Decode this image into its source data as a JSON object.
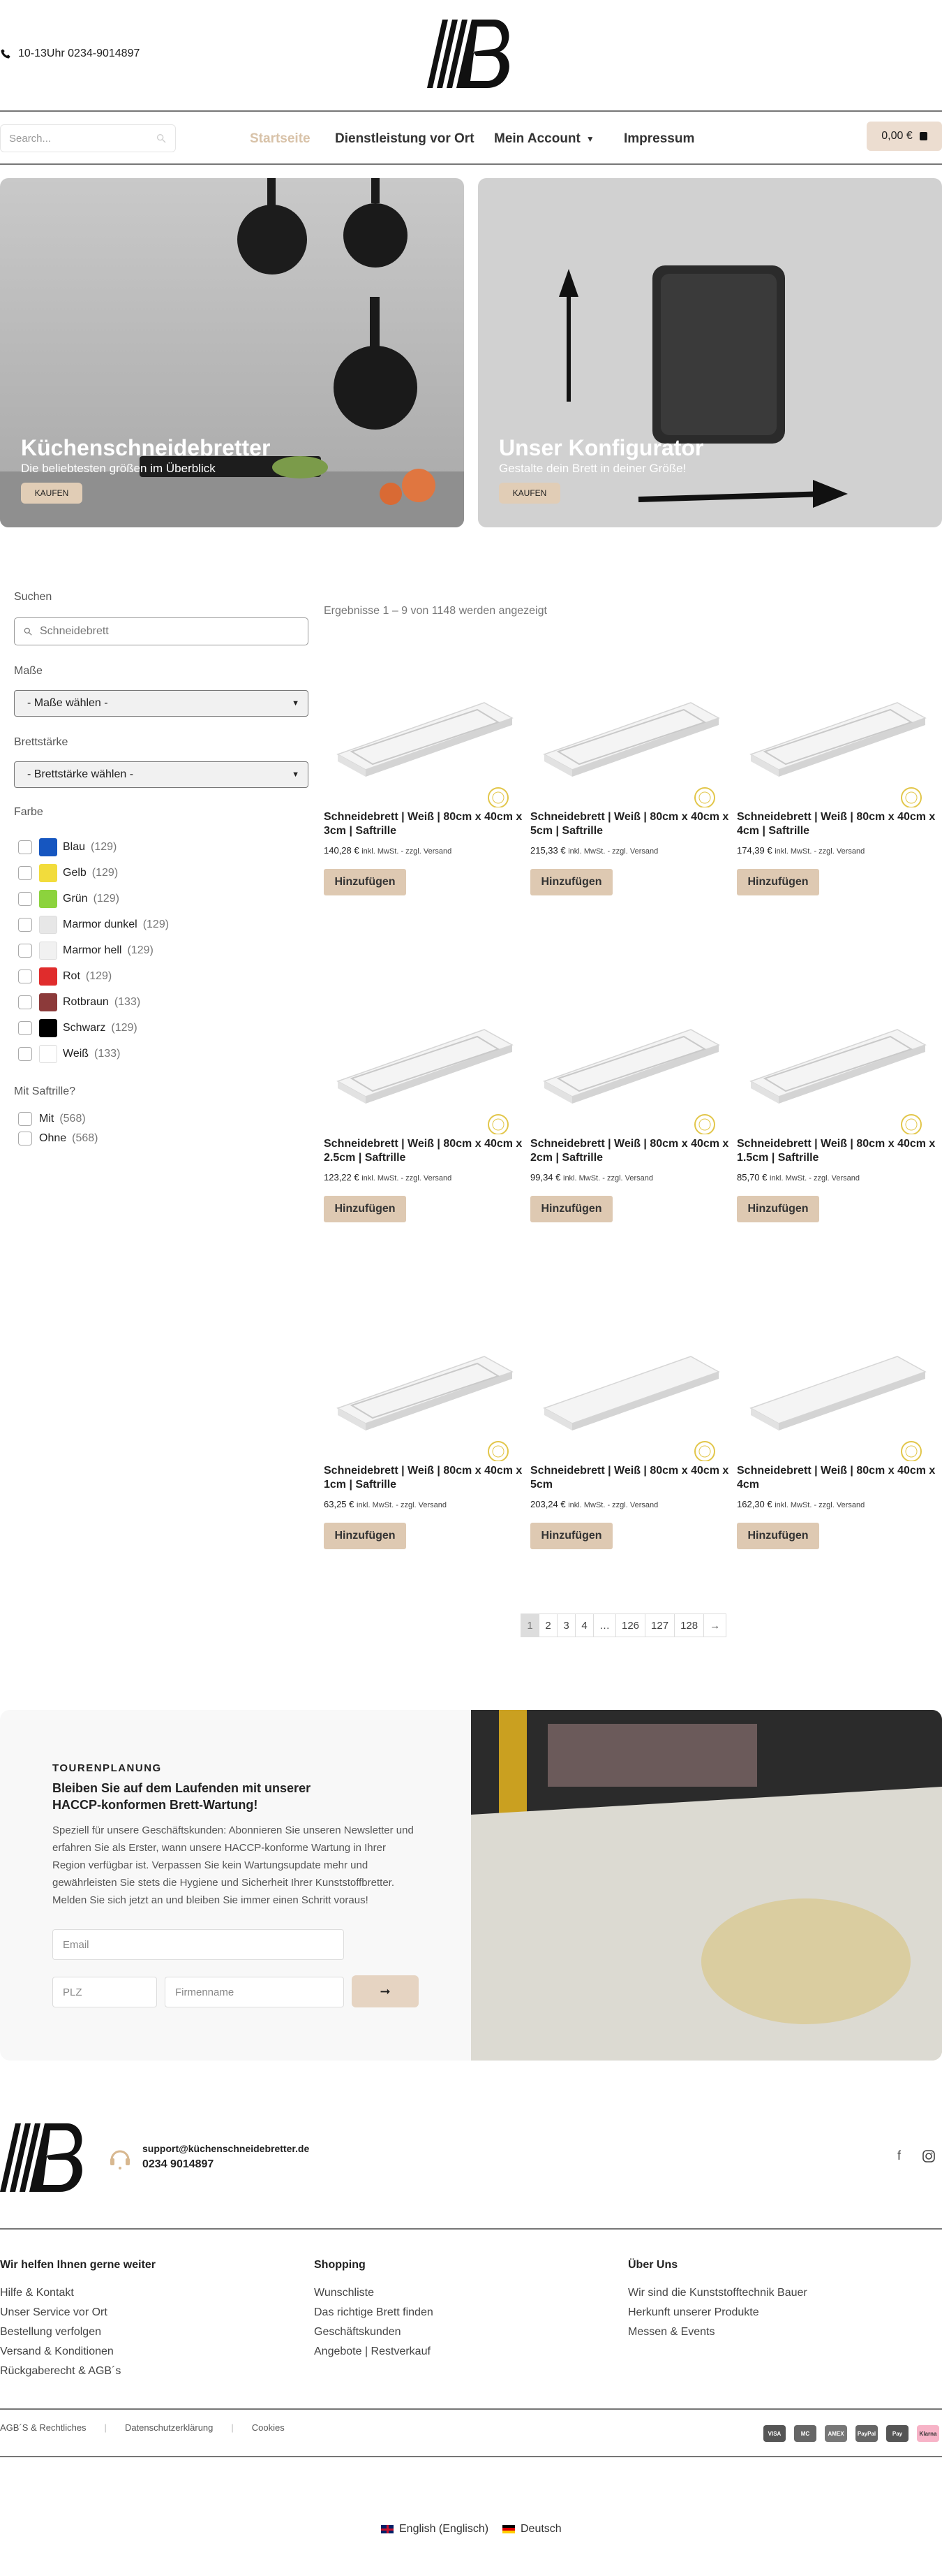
{
  "header": {
    "phone": "10-13Uhr 0234-9014897",
    "search_placeholder": "Search...",
    "nav": [
      "Startseite",
      "Dienstleistung vor Ort",
      "Mein Account",
      "Impressum"
    ],
    "cart_total": "0,00 €"
  },
  "hero": [
    {
      "title": "Küchenschneidebretter",
      "subtitle": "Die beliebtesten größen im Überblick",
      "button": "KAUFEN"
    },
    {
      "title": "Unser Konfigurator",
      "subtitle": "Gestalte dein Brett in deiner Größe!",
      "button": "KAUFEN"
    }
  ],
  "sidebar": {
    "search_label": "Suchen",
    "search_placeholder": "Schneidebrett",
    "size_label": "Maße",
    "size_select": "- Maße wählen -",
    "thickness_label": "Brettstärke",
    "thickness_select": "- Brettstärke wählen -",
    "color_label": "Farbe",
    "colors": [
      {
        "name": "Blau",
        "count": "(129)",
        "hex": "#1656c0"
      },
      {
        "name": "Gelb",
        "count": "(129)",
        "hex": "#f2dc3c"
      },
      {
        "name": "Grün",
        "count": "(129)",
        "hex": "#8cd33d"
      },
      {
        "name": "Marmor dunkel",
        "count": "(129)",
        "hex": "#e7e7e7"
      },
      {
        "name": "Marmor hell",
        "count": "(129)",
        "hex": "#f1f1f1"
      },
      {
        "name": "Rot",
        "count": "(129)",
        "hex": "#e02c2c"
      },
      {
        "name": "Rotbraun",
        "count": "(133)",
        "hex": "#8c3a3a"
      },
      {
        "name": "Schwarz",
        "count": "(129)",
        "hex": "#000000"
      },
      {
        "name": "Weiß",
        "count": "(133)",
        "hex": "#ffffff"
      }
    ],
    "groove_label": "Mit Saftrille?",
    "groove_options": [
      {
        "name": "Mit",
        "count": "(568)"
      },
      {
        "name": "Ohne",
        "count": "(568)"
      }
    ]
  },
  "results_info": "Ergebnisse 1 – 9 von 1148 werden angezeigt",
  "products": [
    {
      "title": "Schneidebrett | Weiß | 80cm x 40cm x 3cm | Saftrille",
      "price": "140,28 €",
      "note": "inkl. MwSt. - zzgl. Versand",
      "button": "Hinzufügen"
    },
    {
      "title": "Schneidebrett | Weiß | 80cm x 40cm x 5cm | Saftrille",
      "price": "215,33 €",
      "note": "inkl. MwSt. - zzgl. Versand",
      "button": "Hinzufügen"
    },
    {
      "title": "Schneidebrett | Weiß | 80cm x 40cm x 4cm | Saftrille",
      "price": "174,39 €",
      "note": "inkl. MwSt. - zzgl. Versand",
      "button": "Hinzufügen"
    },
    {
      "title": "Schneidebrett | Weiß | 80cm x 40cm x 2.5cm | Saftrille",
      "price": "123,22 €",
      "note": "inkl. MwSt. - zzgl. Versand",
      "button": "Hinzufügen"
    },
    {
      "title": "Schneidebrett | Weiß | 80cm x 40cm x 2cm | Saftrille",
      "price": "99,34 €",
      "note": "inkl. MwSt. - zzgl. Versand",
      "button": "Hinzufügen"
    },
    {
      "title": "Schneidebrett | Weiß | 80cm x 40cm x 1.5cm | Saftrille",
      "price": "85,70 €",
      "note": "inkl. MwSt. - zzgl. Versand",
      "button": "Hinzufügen"
    },
    {
      "title": "Schneidebrett | Weiß | 80cm x 40cm x 1cm | Saftrille",
      "price": "63,25 €",
      "note": "inkl. MwSt. - zzgl. Versand",
      "button": "Hinzufügen"
    },
    {
      "title": "Schneidebrett | Weiß | 80cm x 40cm x 5cm",
      "price": "203,24 €",
      "note": "inkl. MwSt. - zzgl. Versand",
      "button": "Hinzufügen"
    },
    {
      "title": "Schneidebrett | Weiß | 80cm x 40cm x 4cm",
      "price": "162,30 €",
      "note": "inkl. MwSt. - zzgl. Versand",
      "button": "Hinzufügen"
    }
  ],
  "pagination": [
    "1",
    "2",
    "3",
    "4",
    "…",
    "126",
    "127",
    "128",
    "→"
  ],
  "newsletter": {
    "kicker": "TOURENPLANUNG",
    "title": "Bleiben Sie auf dem Laufenden mit unserer HACCP-konformen Brett-Wartung!",
    "text": "Speziell für unsere Geschäftskunden: Abonnieren Sie unseren Newsletter und erfahren Sie als Erster, wann unsere HACCP-konforme Wartung in Ihrer Region verfügbar ist. Verpassen Sie kein Wartungsupdate mehr und gewährleisten Sie stets die Hygiene und Sicherheit Ihrer Kunststoffbretter. Melden Sie sich jetzt an und bleiben Sie immer einen Schritt voraus!",
    "email_placeholder": "Email",
    "zip_placeholder": "PLZ",
    "company_placeholder": "Firmenname",
    "submit": "➞"
  },
  "footer": {
    "email": "support@küchenschneidebretter.de",
    "phone": "0234 9014897",
    "columns": [
      {
        "title": "Wir helfen Ihnen gerne weiter",
        "links": [
          "Hilfe & Kontakt",
          "Unser Service vor Ort",
          "Bestellung verfolgen",
          "Versand & Konditionen",
          "Rückgaberecht & AGB´s"
        ]
      },
      {
        "title": "Shopping",
        "links": [
          "Wunschliste",
          "Das richtige Brett finden",
          "Geschäftskunden",
          "Angebote | Restverkauf"
        ]
      },
      {
        "title": "Über Uns",
        "links": [
          "Wir sind die Kunststofftechnik Bauer",
          "Herkunft unserer Produkte",
          "Messen & Events"
        ]
      }
    ],
    "legal": [
      "AGB´S & Rechtliches",
      "Datenschutzerklärung",
      "Cookies"
    ],
    "payments": [
      "VISA",
      "MC",
      "AMEX",
      "PayPal",
      "Pay",
      "Klarna"
    ],
    "languages": [
      "English (Englisch)",
      "Deutsch"
    ]
  }
}
